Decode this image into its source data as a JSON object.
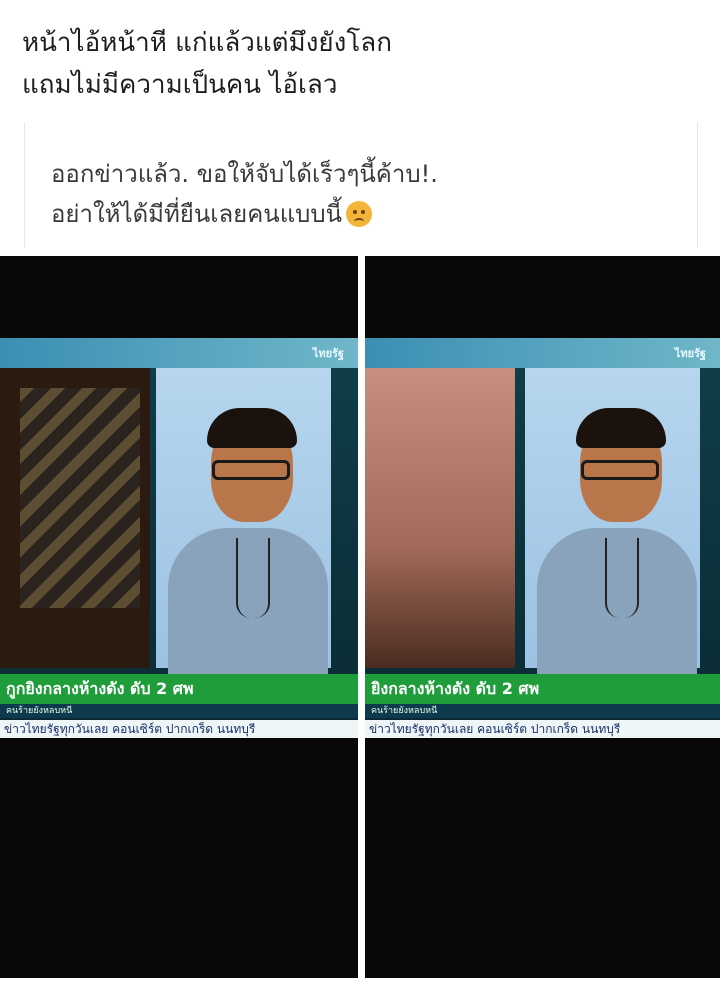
{
  "post": {
    "caption_lines": [
      "หน้าไอ้หน้าหี แก่แล้วแต่มึงยังโลก",
      "แถมไม่มีความเป็นคน ไอ้เลว"
    ]
  },
  "quoted_post": {
    "lines": [
      "ออกข่าวแล้ว. ขอให้จับได้เร็วๆนี้ค้าบ!.",
      "อย่าให้ได้มีที่ยืนเลยคนแบบนี้"
    ],
    "emoji": "frowning-face-icon"
  },
  "tv_left": {
    "channel_logo": "ไทยรัฐ",
    "headline": "กูกยิงกลางห้างดัง ดับ 2 ศพ",
    "subline": "คนร้ายยังหลบหนี",
    "ticker": "ข่าวไทยรัฐทุกวันเลย คอนเซิร์ต ปากเกร็ด นนทบุรี"
  },
  "tv_right": {
    "channel_logo": "ไทยรัฐ",
    "headline": "ยิงกลางห้างดัง ดับ 2 ศพ",
    "subline": "คนร้ายยังหลบหนี",
    "ticker": "ข่าวไทยรัฐทุกวันเลย คอนเซิร์ต ปากเกร็ด นนทบุรี"
  },
  "colors": {
    "news_green": "#1f9d3a",
    "news_blue": "#3b8fb3",
    "text_dark": "#1c1e21"
  }
}
